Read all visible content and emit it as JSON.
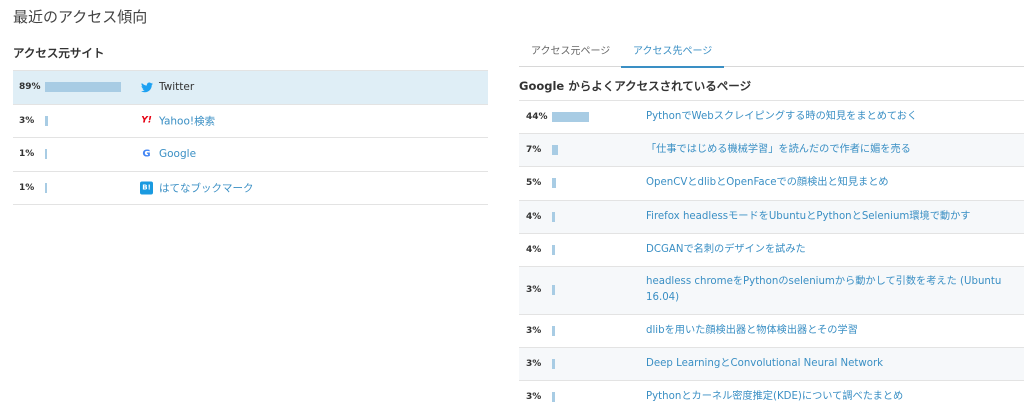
{
  "page_title": "最近のアクセス傾向",
  "left": {
    "heading": "アクセス元サイト",
    "rows": [
      {
        "percent_label": "89%",
        "percent": 89,
        "icon": "twitter-icon",
        "label": "Twitter",
        "highlight": true
      },
      {
        "percent_label": "3%",
        "percent": 3,
        "icon": "yahoo-icon",
        "icon_text": "Y!",
        "label": "Yahoo!検索",
        "highlight": false
      },
      {
        "percent_label": "1%",
        "percent": 1,
        "icon": "google-icon",
        "icon_text": "G",
        "label": "Google",
        "highlight": false
      },
      {
        "percent_label": "1%",
        "percent": 1,
        "icon": "hatena-bookmark-icon",
        "icon_text": "B!",
        "label": "はてなブックマーク",
        "highlight": false
      }
    ]
  },
  "right": {
    "tabs": [
      {
        "label": "アクセス元ページ",
        "active": false
      },
      {
        "label": "アクセス先ページ",
        "active": true
      }
    ],
    "heading": "Google からよくアクセスされているページ",
    "rows": [
      {
        "percent_label": "44%",
        "percent": 44,
        "label": "PythonでWebスクレイピングする時の知見をまとめておく"
      },
      {
        "percent_label": "7%",
        "percent": 7,
        "label": "「仕事ではじめる機械学習」を読んだので作者に媚を売る"
      },
      {
        "percent_label": "5%",
        "percent": 5,
        "label": "OpenCVとdlibとOpenFaceでの顔検出と知見まとめ"
      },
      {
        "percent_label": "4%",
        "percent": 4,
        "label": "Firefox headlessモードをUbuntuとPythonとSelenium環境で動かす"
      },
      {
        "percent_label": "4%",
        "percent": 4,
        "label": "DCGANで名刺のデザインを試みた"
      },
      {
        "percent_label": "3%",
        "percent": 3,
        "label": "headless chromeをPythonのseleniumから動かして引数を考えた (Ubuntu 16.04)"
      },
      {
        "percent_label": "3%",
        "percent": 3,
        "label": "dlibを用いた顔検出器と物体検出器とその学習"
      },
      {
        "percent_label": "3%",
        "percent": 3,
        "label": "Deep LearningとConvolutional Neural Network"
      },
      {
        "percent_label": "3%",
        "percent": 3,
        "label": "Pythonとカーネル密度推定(KDE)について調べたまとめ"
      }
    ]
  },
  "colors": {
    "accent": "#3a8fc4",
    "bar": "#a8cce4",
    "highlight_row": "#dfeef6",
    "twitter": "#1da1f2",
    "yahoo": "#e60012",
    "hatena": "#1a9ae0"
  }
}
